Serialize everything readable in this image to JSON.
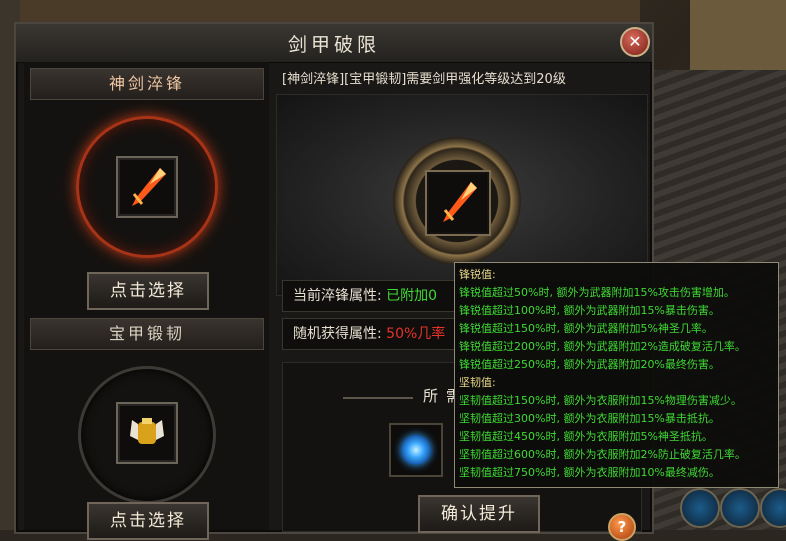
{
  "window": {
    "title": "剑甲破限"
  },
  "left": {
    "sword": {
      "header": "神剑淬锋",
      "button": "点击选择"
    },
    "armor": {
      "header": "宝甲锻韧",
      "button": "点击选择"
    }
  },
  "right": {
    "requirement": "[神剑淬锋][宝甲锻韧]需要剑甲强化等级达到20级",
    "current_label": "当前淬锋属性:",
    "current_value": "已附加0",
    "random_label": "随机获得属性:",
    "random_value": "50%几率",
    "need_label": "所需",
    "confirm_button": "确认提升",
    "help_glyph": "?"
  },
  "tooltip": {
    "lines": [
      {
        "text": "锋锐值:",
        "head": true
      },
      {
        "text": "锋锐值超过50%时, 额外为武器附加15%攻击伤害增加。"
      },
      {
        "text": "锋锐值超过100%时, 额外为武器附加15%暴击伤害。"
      },
      {
        "text": "锋锐值超过150%时, 额外为武器附加5%神圣几率。"
      },
      {
        "text": "锋锐值超过200%时, 额外为武器附加2%造成破复活几率。"
      },
      {
        "text": "锋锐值超过250%时, 额外为武器附加20%最终伤害。"
      },
      {
        "text": "坚韧值:",
        "head": true
      },
      {
        "text": "坚韧值超过150%时, 额外为衣服附加15%物理伤害减少。"
      },
      {
        "text": "坚韧值超过300%时, 额外为衣服附加15%暴击抵抗。"
      },
      {
        "text": "坚韧值超过450%时, 额外为衣服附加5%神圣抵抗。"
      },
      {
        "text": "坚韧值超过600%时, 额外为衣服附加2%防止破复活几率。"
      },
      {
        "text": "坚韧值超过750%时, 额外为衣服附加10%最终减伤。"
      }
    ]
  },
  "colors": {
    "green": "#3fd934",
    "red": "#e5332a",
    "gold": "#e6d68a"
  }
}
